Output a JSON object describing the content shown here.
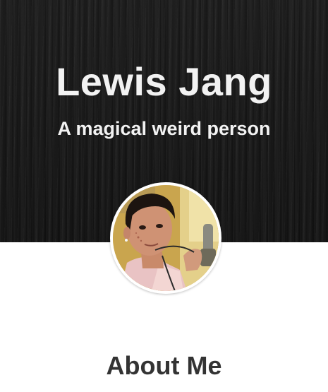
{
  "header": {
    "name": "Lewis Jang",
    "tagline": "A magical weird person"
  },
  "profile": {
    "photo_alt": "Portrait photo of Lewis Jang"
  },
  "about": {
    "title": "About Me"
  },
  "colors": {
    "hero_background": "#141414",
    "hero_text": "#f2f2f2",
    "page_background": "#ffffff",
    "section_title": "#333333"
  }
}
